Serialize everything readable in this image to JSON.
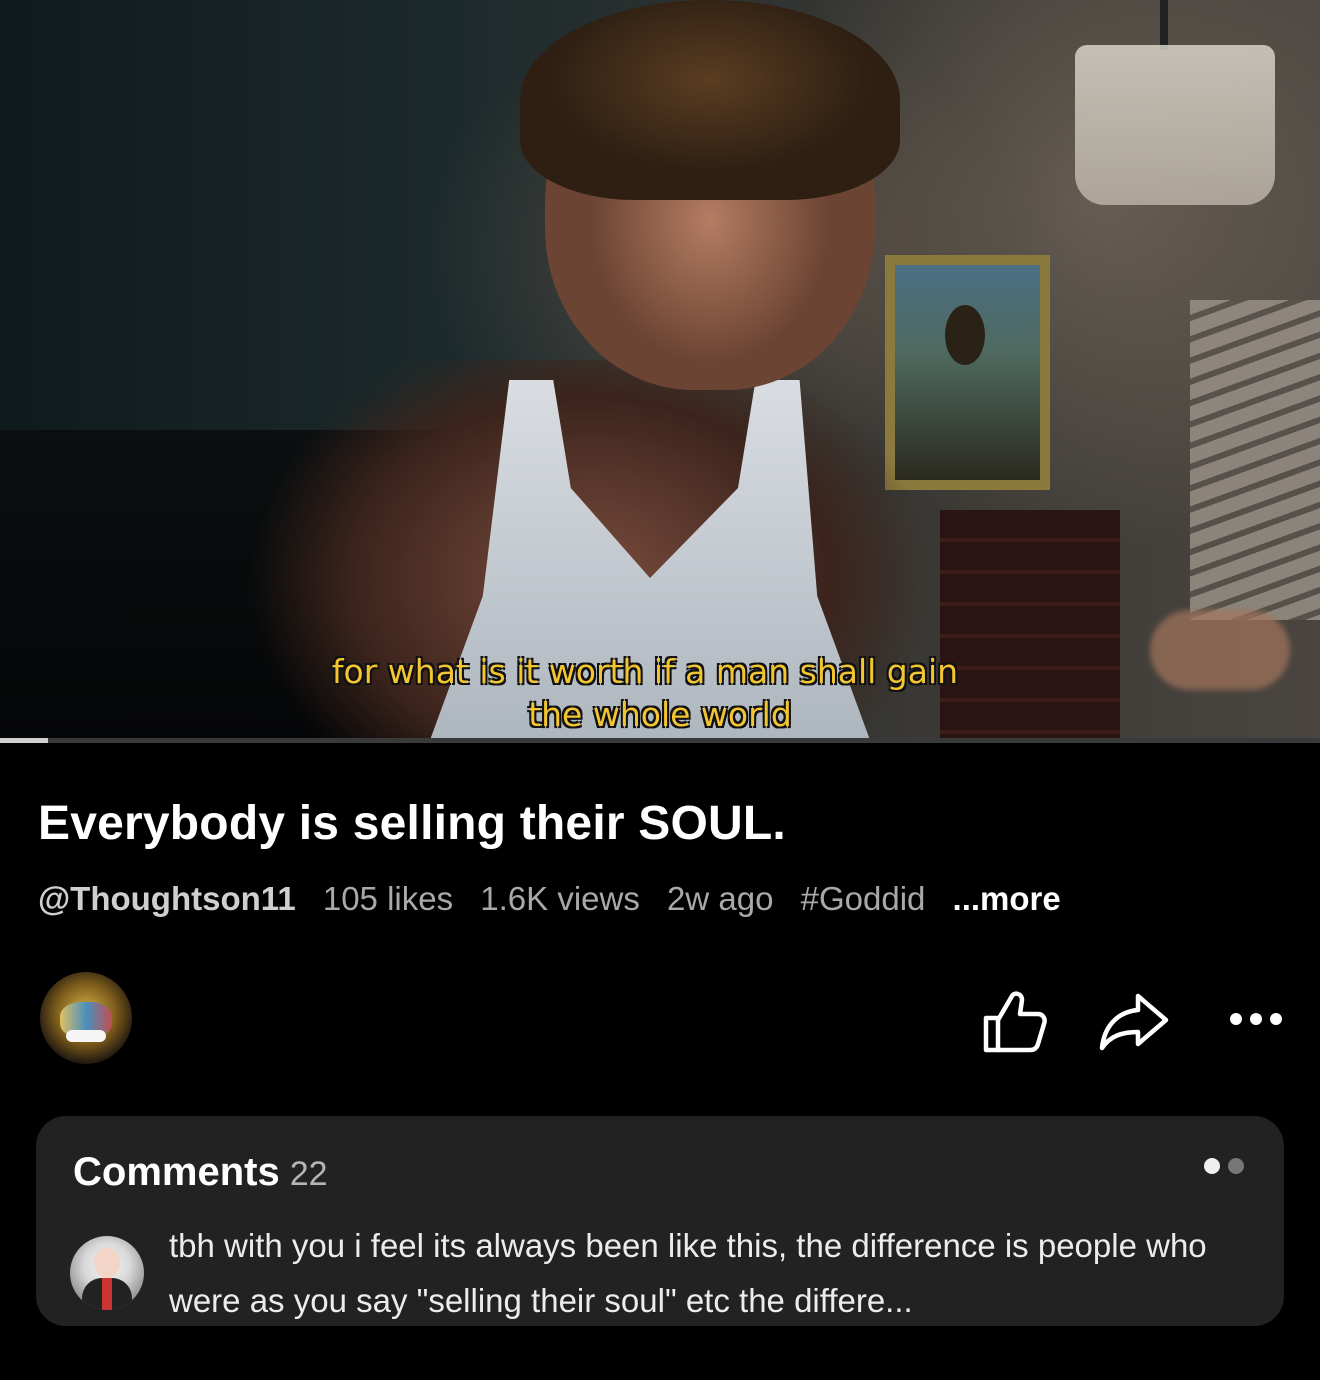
{
  "video": {
    "caption_line1": "for what is it worth if a man shall gain",
    "caption_line2": "the whole world",
    "progress_fraction": 0.036
  },
  "title": "Everybody is selling their SOUL.",
  "meta": {
    "channel": "@Thoughtson11",
    "likes": "105 likes",
    "views": "1.6K views",
    "age": "2w ago",
    "hashtag": "#Goddid",
    "more": "...more"
  },
  "actions": {
    "like_icon": "thumbs-up-icon",
    "share_icon": "share-arrow-icon",
    "more_icon": "more-horizontal-icon"
  },
  "comments": {
    "label": "Comments",
    "count": "22",
    "top_comment": "tbh with you i feel its always been like this, the difference is people who were as you say \"selling their soul\" etc the differe..."
  },
  "colors": {
    "caption": "#f2c531",
    "background": "#000000",
    "card": "#222222"
  }
}
